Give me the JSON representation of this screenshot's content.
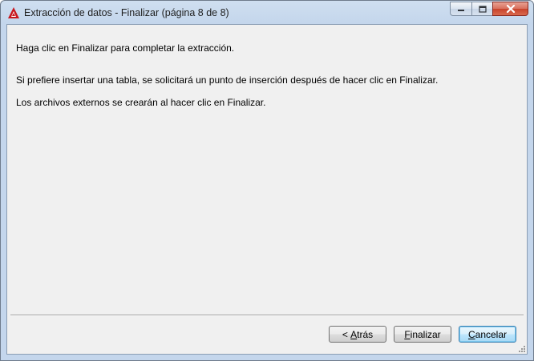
{
  "window": {
    "title": "Extracción de datos - Finalizar (página 8 de 8)"
  },
  "messages": [
    "Haga clic en Finalizar para completar la extracción.",
    "Si prefiere insertar una tabla, se solicitará un punto de inserción después de hacer clic en Finalizar.",
    "Los archivos externos se crearán al hacer clic en Finalizar."
  ],
  "buttons": {
    "back": {
      "prefix": "< ",
      "accel": "A",
      "rest": "trás"
    },
    "finish": {
      "prefix": "",
      "accel": "F",
      "rest": "inalizar"
    },
    "cancel": {
      "prefix": "",
      "accel": "C",
      "rest": "ancelar"
    }
  },
  "icons": {
    "app": "autocad-logo-icon",
    "minimize": "minimize-icon",
    "maximize": "maximize-icon",
    "close": "close-icon"
  },
  "colors": {
    "app_icon": "#c8161d",
    "close_button": "#c8432c"
  }
}
